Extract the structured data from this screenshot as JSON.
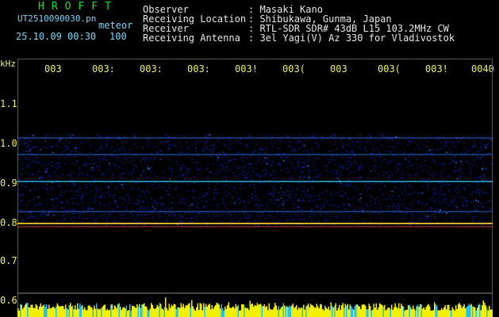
{
  "header": {
    "brand": "HROFFT",
    "filename": "UT2510090030.pn",
    "mode": "meteor",
    "datetime": "25.10.09 00:30",
    "gain": "100",
    "fields": [
      {
        "label": "Observer",
        "value": ": Masaki Kano"
      },
      {
        "label": "Receiving Location",
        "value": ": Shibukawa, Gunma, Japan"
      },
      {
        "label": "Receiver",
        "value": ": RTL-SDR SDR# 43dB L15 103.2MHz CW"
      },
      {
        "label": "Receiving Antenna",
        "value": ": 3el Yagi(V) Az 330 for Vladivostok"
      }
    ]
  },
  "axis": {
    "unit": "kHz",
    "ticks": [
      "1.1",
      "1.0",
      "0.9",
      "0.8",
      "0.7",
      "0.6"
    ],
    "time_labels": [
      "003",
      "003:",
      "003:",
      "003:",
      "003!",
      "003(",
      "003",
      "003(",
      "003!",
      "0040"
    ]
  },
  "colors": {
    "background": "#000000",
    "signal_low": "#0a1ea0",
    "signal_mid": "#2e7cff",
    "signal_high": "#ffd030",
    "grid": "#ffffff",
    "activity": "#f0f000",
    "activity_alt": "#20c0ff"
  }
}
